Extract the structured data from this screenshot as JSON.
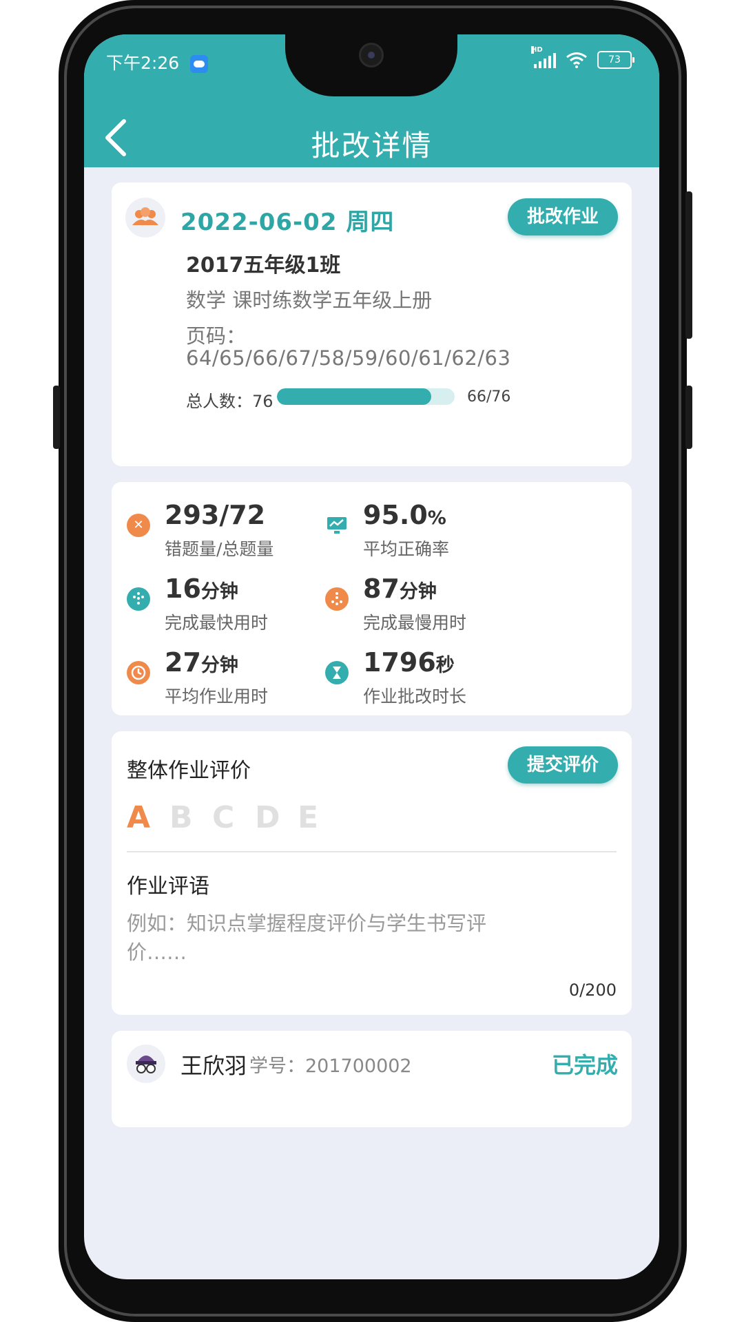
{
  "status_bar": {
    "time": "下午2:26",
    "battery": "73"
  },
  "header": {
    "title": "批改详情"
  },
  "summary": {
    "date": "2022-06-02 周四",
    "action_label": "批改作业",
    "class_name": "2017五年级1班",
    "subject": "数学 课时练数学五年级上册",
    "pages_label": "页码：",
    "pages_value": "64/65/66/67/58/59/60/61/62/63",
    "total_label": "总人数：76",
    "progress_text": "66/76",
    "progress_fraction": 0.868
  },
  "stats": [
    {
      "value": "293/72",
      "unit": "",
      "label": "错题量/总题量",
      "icon": "error-x-icon",
      "color": "#f08a4b"
    },
    {
      "value": "95.0",
      "unit": "%",
      "label": "平均正确率",
      "icon": "monitor-chart-icon",
      "color": "#33adad"
    },
    {
      "value": "16",
      "unit": "分钟",
      "label": "完成最快用时",
      "icon": "fastest-icon",
      "color": "#33adad"
    },
    {
      "value": "87",
      "unit": "分钟",
      "label": "完成最慢用时",
      "icon": "slowest-icon",
      "color": "#f08a4b"
    },
    {
      "value": "27",
      "unit": "分钟",
      "label": "平均作业用时",
      "icon": "clock-icon",
      "color": "#f08a4b"
    },
    {
      "value": "1796",
      "unit": "秒",
      "label": "作业批改时长",
      "icon": "hourglass-icon",
      "color": "#33adad"
    }
  ],
  "evaluation": {
    "title": "整体作业评价",
    "submit_label": "提交评价",
    "grades": [
      "A",
      "B",
      "C",
      "D",
      "E"
    ],
    "selected_grade": "A",
    "comment_title": "作业评语",
    "comment_placeholder": "例如：知识点掌握程度评价与学生书写评价……",
    "counter": "0/200"
  },
  "student": {
    "name": "王欣羽",
    "id_text": "学号：201700002",
    "status": "已完成"
  },
  "colors": {
    "accent": "#33adad",
    "orange": "#f08a4b",
    "background": "#eceef7"
  }
}
